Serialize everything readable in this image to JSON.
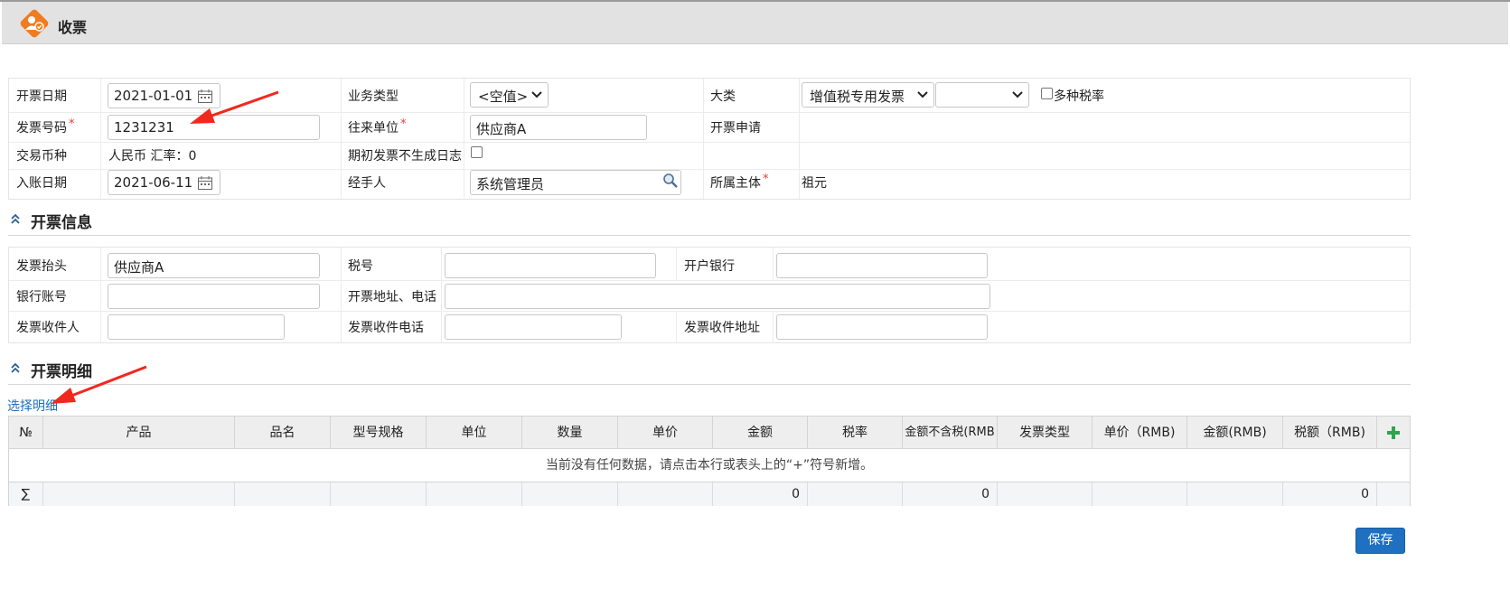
{
  "window": {
    "title": "收票"
  },
  "header_form": {
    "invoice_date_label": "开票日期",
    "invoice_date_value": "2021-01-01",
    "business_type_label": "业务类型",
    "business_type_value": "<空值>",
    "category_label": "大类",
    "category_value": "增值税专用发票",
    "category_sub_value": "",
    "multi_tax_label": "多种税率",
    "invoice_no_label": "发票号码",
    "invoice_no_value": "1231231",
    "partner_label": "往来单位",
    "partner_value": "供应商A",
    "invoice_request_label": "开票申请",
    "currency_label": "交易币种",
    "currency_value": "人民币 汇率：0",
    "no_log_label": "期初发票不生成日志",
    "posting_date_label": "入账日期",
    "posting_date_value": "2021-06-11",
    "handler_label": "经手人",
    "handler_value": "系统管理员",
    "entity_label": "所属主体",
    "entity_value": "祖元",
    "required_mark": "*"
  },
  "invoice_info": {
    "section_title": "开票信息",
    "title_label": "发票抬头",
    "title_value": "供应商A",
    "tax_no_label": "税号",
    "tax_no_value": "",
    "bank_label": "开户银行",
    "bank_value": "",
    "account_label": "银行账号",
    "account_value": "",
    "address_phone_label": "开票地址、电话",
    "address_phone_value": "",
    "recipient_label": "发票收件人",
    "recipient_value": "",
    "recipient_phone_label": "发票收件电话",
    "recipient_phone_value": "",
    "recipient_address_label": "发票收件地址",
    "recipient_address_value": ""
  },
  "details": {
    "section_title": "开票明细",
    "select_link": "选择明细",
    "columns": [
      "№",
      "产品",
      "品名",
      "型号规格",
      "单位",
      "数量",
      "单价",
      "金额",
      "税率",
      "金额不含税(RMB",
      "发票类型",
      "单价（RMB)",
      "金额(RMB)",
      "税额（RMB)"
    ],
    "empty_text": "当前没有任何数据，请点击本行或表头上的“+”符号新增。",
    "sum_symbol": "∑",
    "sum_amount": "0",
    "sum_amount_ex_tax": "0",
    "sum_tax_rmb": "0"
  },
  "actions": {
    "save_label": "保存"
  },
  "colors": {
    "accent": "#1f70c1",
    "icon_orange": "#f07c1e",
    "required": "#e53935",
    "arrow": "#f0281e"
  }
}
